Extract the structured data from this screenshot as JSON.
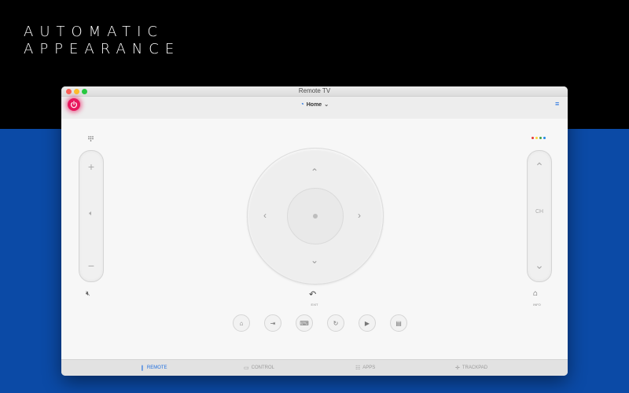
{
  "headline": {
    "line1": "AUTOMATIC",
    "line2": "APPEARANCE"
  },
  "window": {
    "title": "Remote TV"
  },
  "toolbar": {
    "device_name": "Home"
  },
  "remote": {
    "volume": {
      "up": "+",
      "down": "−"
    },
    "channel": {
      "label": "CH"
    },
    "exit_label": "EXIT",
    "info_label": "INFO",
    "color_dots": [
      "#e53935",
      "#fdd835",
      "#43a047",
      "#1e88e5"
    ]
  },
  "tabs": [
    {
      "label": "REMOTE",
      "active": true
    },
    {
      "label": "CONTROL",
      "active": false
    },
    {
      "label": "APPS",
      "active": false
    },
    {
      "label": "TRACKPAD",
      "active": false
    }
  ],
  "colors": {
    "accent": "#1f6fe0",
    "power": "#e8175d",
    "background_blue": "#0b4aa6"
  }
}
